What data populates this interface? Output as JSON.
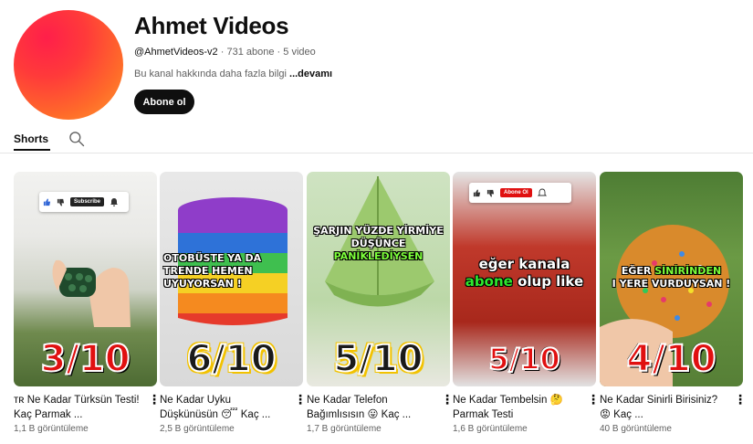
{
  "channel": {
    "title": "Ahmet Videos",
    "handle": "@AhmetVideos-v2",
    "subscribers": "731 abone",
    "video_count": "5 video",
    "about": "Bu kanal hakkında daha fazla bilgi",
    "about_more": "...devamı",
    "subscribe_label": "Abone ol",
    "avatar_colors": [
      "#ff1f4a",
      "#ff9a2e"
    ]
  },
  "tabs": {
    "shorts_label": "Shorts"
  },
  "shorts": [
    {
      "title": "ᴛʀ Ne Kadar Türksün Testi! Kaç Parmak ...",
      "views": "1,1 B görüntüleme",
      "score": "3/10",
      "overlay_subscribe": "Subscribe"
    },
    {
      "title": "Ne Kadar Uyku Düşkünüsün 😴 Kaç ...",
      "views": "2,5 B görüntüleme",
      "score": "6/10",
      "caption": "OTOBÜSTE YA DA TRENDE HEMEN UYUYORSAN !"
    },
    {
      "title": "Ne Kadar Telefon Bağımlısısın 😛 Kaç ...",
      "views": "1,7 B görüntüleme",
      "score": "5/10",
      "caption": "ŞARJIN YÜZDE YİRMİYE DÜŞÜNCE",
      "caption_highlight": "PANİKLEDİYSEN"
    },
    {
      "title": "Ne Kadar Tembelsin 🤔 Parmak Testi",
      "views": "1,6 B görüntüleme",
      "score": "5/10",
      "caption_pre": "eğer kanala",
      "caption_highlight": "abone",
      "caption_post": "olup like",
      "overlay_subscribe": "Abone Ol"
    },
    {
      "title": "Ne Kadar Sinirli Birisiniz? 😡 Kaç ...",
      "views": "40 B görüntüleme",
      "score": "4/10",
      "caption_pre": "EĞER",
      "caption_highlight": "SİNİRİNDEN",
      "caption_post": "I YERE VURDUYSAN !"
    }
  ]
}
